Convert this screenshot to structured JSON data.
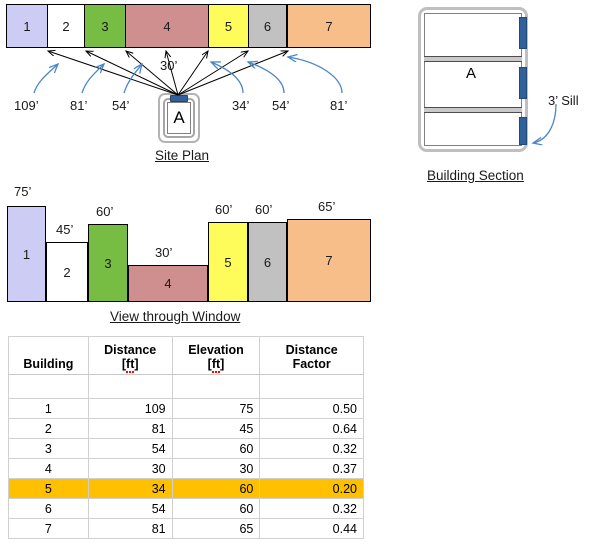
{
  "site_plan": {
    "caption": "Site Plan",
    "viewer_label": "A",
    "center_distance": "30’",
    "buildings": [
      {
        "id": "1",
        "color": "#CCCCF5"
      },
      {
        "id": "2",
        "color": "#FFFFFF"
      },
      {
        "id": "3",
        "color": "#77BC43"
      },
      {
        "id": "4",
        "color": "#D08F8F"
      },
      {
        "id": "5",
        "color": "#FDFC5A"
      },
      {
        "id": "6",
        "color": "#C1C1C1"
      },
      {
        "id": "7",
        "color": "#F7BE8A"
      }
    ],
    "distance_labels": [
      "109’",
      "81’",
      "54’",
      "34’",
      "54’",
      "81’"
    ]
  },
  "building_section": {
    "caption": "Building Section",
    "room_label": "A",
    "sill_label": "3’ Sill"
  },
  "view_through_window": {
    "caption": "View through Window",
    "bars": [
      {
        "id": "1",
        "height_label": "75’",
        "color": "#CCCCF5"
      },
      {
        "id": "2",
        "height_label": "45’",
        "color": "#FFFFFF"
      },
      {
        "id": "3",
        "height_label": "60’",
        "color": "#77BC43"
      },
      {
        "id": "4",
        "height_label": "30’",
        "color": "#D08F8F"
      },
      {
        "id": "5",
        "height_label": "60’",
        "color": "#FDFC5A"
      },
      {
        "id": "6",
        "height_label": "60’",
        "color": "#C1C1C1"
      },
      {
        "id": "7",
        "height_label": "65’",
        "color": "#F7BE8A"
      }
    ]
  },
  "table": {
    "headers": [
      "Building",
      "Distance [ft]",
      "Elevation [ft]",
      "Distance Factor"
    ],
    "header_parts": {
      "distance_main": "Distance [",
      "distance_sq": "ft",
      "distance_end": "]",
      "elevation_main": "Elevation [",
      "elevation_sq": "ft",
      "elevation_end": "]"
    },
    "highlight_color": "#FFC000",
    "highlight_row_index": 4,
    "rows": [
      {
        "building": "1",
        "distance": "109",
        "elevation": "75",
        "factor": "0.50"
      },
      {
        "building": "2",
        "distance": "81",
        "elevation": "45",
        "factor": "0.64"
      },
      {
        "building": "3",
        "distance": "54",
        "elevation": "60",
        "factor": "0.32"
      },
      {
        "building": "4",
        "distance": "30",
        "elevation": "30",
        "factor": "0.37"
      },
      {
        "building": "5",
        "distance": "34",
        "elevation": "60",
        "factor": "0.20"
      },
      {
        "building": "6",
        "distance": "54",
        "elevation": "60",
        "factor": "0.32"
      },
      {
        "building": "7",
        "distance": "81",
        "elevation": "65",
        "factor": "0.44"
      }
    ]
  },
  "chart_data": {
    "type": "bar",
    "title": "View through Window",
    "categories": [
      "1",
      "2",
      "3",
      "4",
      "5",
      "6",
      "7"
    ],
    "series": [
      {
        "name": "Elevation [ft]",
        "values": [
          75,
          45,
          60,
          30,
          60,
          60,
          65
        ]
      },
      {
        "name": "Distance [ft]",
        "values": [
          109,
          81,
          54,
          30,
          34,
          54,
          81
        ]
      },
      {
        "name": "Distance Factor",
        "values": [
          0.5,
          0.64,
          0.32,
          0.37,
          0.2,
          0.32,
          0.44
        ]
      }
    ],
    "xlabel": "Building",
    "ylabel": "Elevation [ft]",
    "ylim": [
      0,
      80
    ],
    "grid": false,
    "legend": "none",
    "colors": [
      "#CCCCF5",
      "#FFFFFF",
      "#77BC43",
      "#D08F8F",
      "#FDFC5A",
      "#C1C1C1",
      "#F7BE8A"
    ]
  }
}
